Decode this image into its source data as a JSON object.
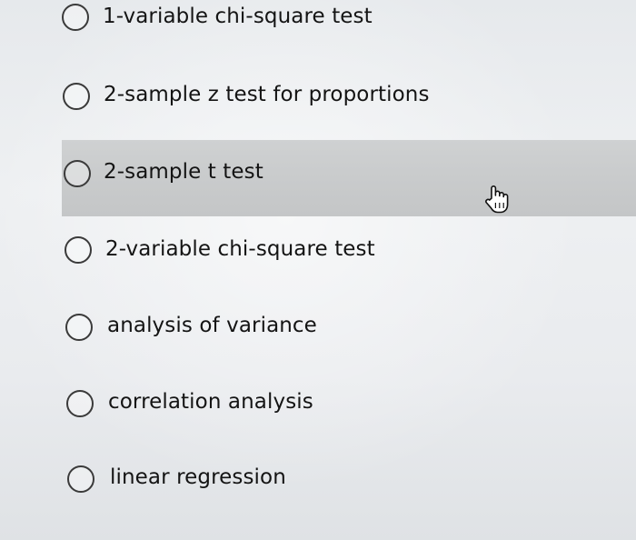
{
  "question": {
    "options": [
      {
        "label": "1-variable chi-square test",
        "selected": false
      },
      {
        "label": "2-sample z test for proportions",
        "selected": false
      },
      {
        "label": "2-sample t test",
        "selected": false
      },
      {
        "label": "2-variable chi-square test",
        "selected": false
      },
      {
        "label": "analysis of variance",
        "selected": false
      },
      {
        "label": "correlation analysis",
        "selected": false
      },
      {
        "label": "linear regression",
        "selected": false
      }
    ],
    "hovered_option": "2-sample t test"
  },
  "cursor": {
    "icon": "hand-pointer-icon"
  },
  "colors": {
    "background": "#eceef0",
    "hover_highlight": "#c9cbcc",
    "radio_border": "#3a3a3a",
    "text": "#141414"
  }
}
